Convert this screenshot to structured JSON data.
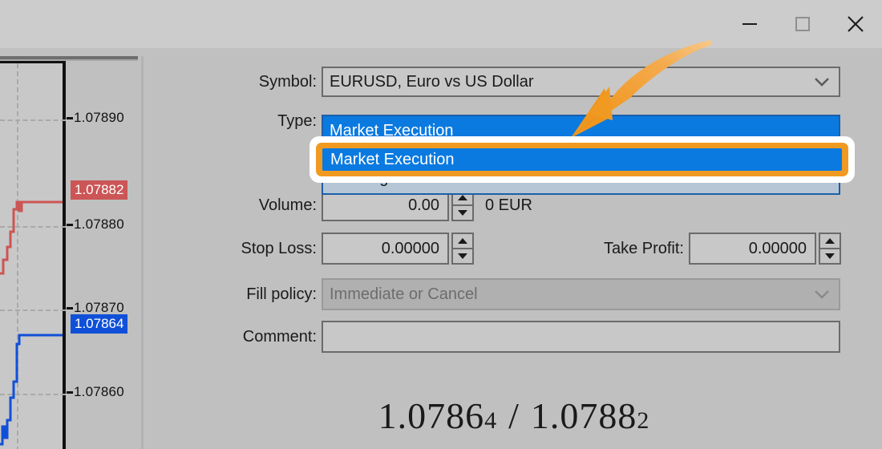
{
  "window": {
    "controls": [
      {
        "name": "minimize",
        "glyph": "minimize-icon"
      },
      {
        "name": "maximize",
        "glyph": "maximize-icon"
      },
      {
        "name": "close",
        "glyph": "close-icon"
      }
    ]
  },
  "chart": {
    "scale_labels": [
      "1.07890",
      "1.07880",
      "1.07870",
      "1.07860"
    ],
    "ask_price": "1.07882",
    "bid_price": "1.07864",
    "ask_color": "#cc5555",
    "bid_color": "#1050d8"
  },
  "form": {
    "symbol": {
      "label": "Symbol:",
      "value": "EURUSD, Euro vs US Dollar"
    },
    "type": {
      "label": "Type:",
      "value": "Market Execution",
      "options": [
        "Market Execution",
        "Pending Order"
      ]
    },
    "volume": {
      "label": "Volume:",
      "value": "0.00",
      "unit": "0 EUR"
    },
    "stop_loss": {
      "label": "Stop Loss:",
      "value": "0.00000"
    },
    "take_profit": {
      "label": "Take Profit:",
      "value": "0.00000"
    },
    "fill_policy": {
      "label": "Fill policy:",
      "value": "Immediate or Cancel"
    },
    "comment": {
      "label": "Comment:",
      "value": ""
    }
  },
  "quote": {
    "bid_main": "1.0786",
    "bid_last": "4",
    "separator": "/",
    "ask_main": "1.0788",
    "ask_last": "2"
  },
  "annotation": {
    "highlight_text": "Market Execution",
    "highlight_color": "#f09a22",
    "selection_color": "#0a7ae0"
  }
}
